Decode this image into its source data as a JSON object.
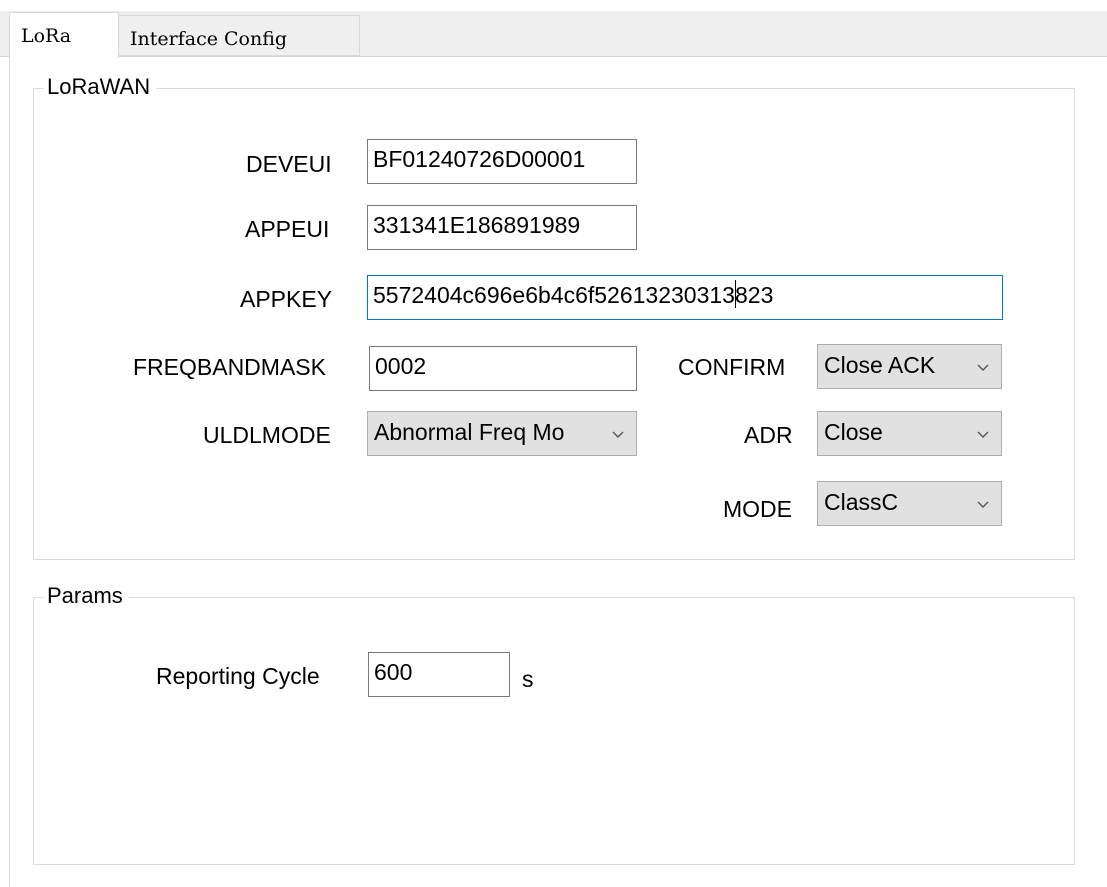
{
  "tabs": [
    {
      "label": "LoRa",
      "active": true
    },
    {
      "label": "Interface Config",
      "active": false
    }
  ],
  "lorawan": {
    "title": "LoRaWAN",
    "deveui": {
      "label": "DEVEUI",
      "value": "BF01240726D00001"
    },
    "appeui": {
      "label": "APPEUI",
      "value": "331341E186891989"
    },
    "appkey": {
      "label": "APPKEY",
      "value_before_caret": "557240 4c696e6b4c6f5261323031 3",
      "value_after_caret": "823",
      "value": "5572404c696e6b4c6f52613230313823"
    },
    "freqbandmask": {
      "label": "FREQBANDMASK",
      "value": "0002"
    },
    "confirm": {
      "label": "CONFIRM",
      "selected": "Close ACK"
    },
    "uldlmode": {
      "label": "ULDLMODE",
      "selected": "Abnormal Freq Mo"
    },
    "adr": {
      "label": "ADR",
      "selected": "Close"
    },
    "mode": {
      "label": "MODE",
      "selected": "ClassC"
    }
  },
  "params": {
    "title": "Params",
    "reporting_cycle": {
      "label": "Reporting Cycle",
      "value": "600",
      "unit": "s"
    }
  },
  "icons": {
    "dropdown": "chevron-down-icon"
  },
  "colors": {
    "focus_border": "#0078d7",
    "combo_bg": "#e1e1e1",
    "tab_strip": "#efefef"
  }
}
